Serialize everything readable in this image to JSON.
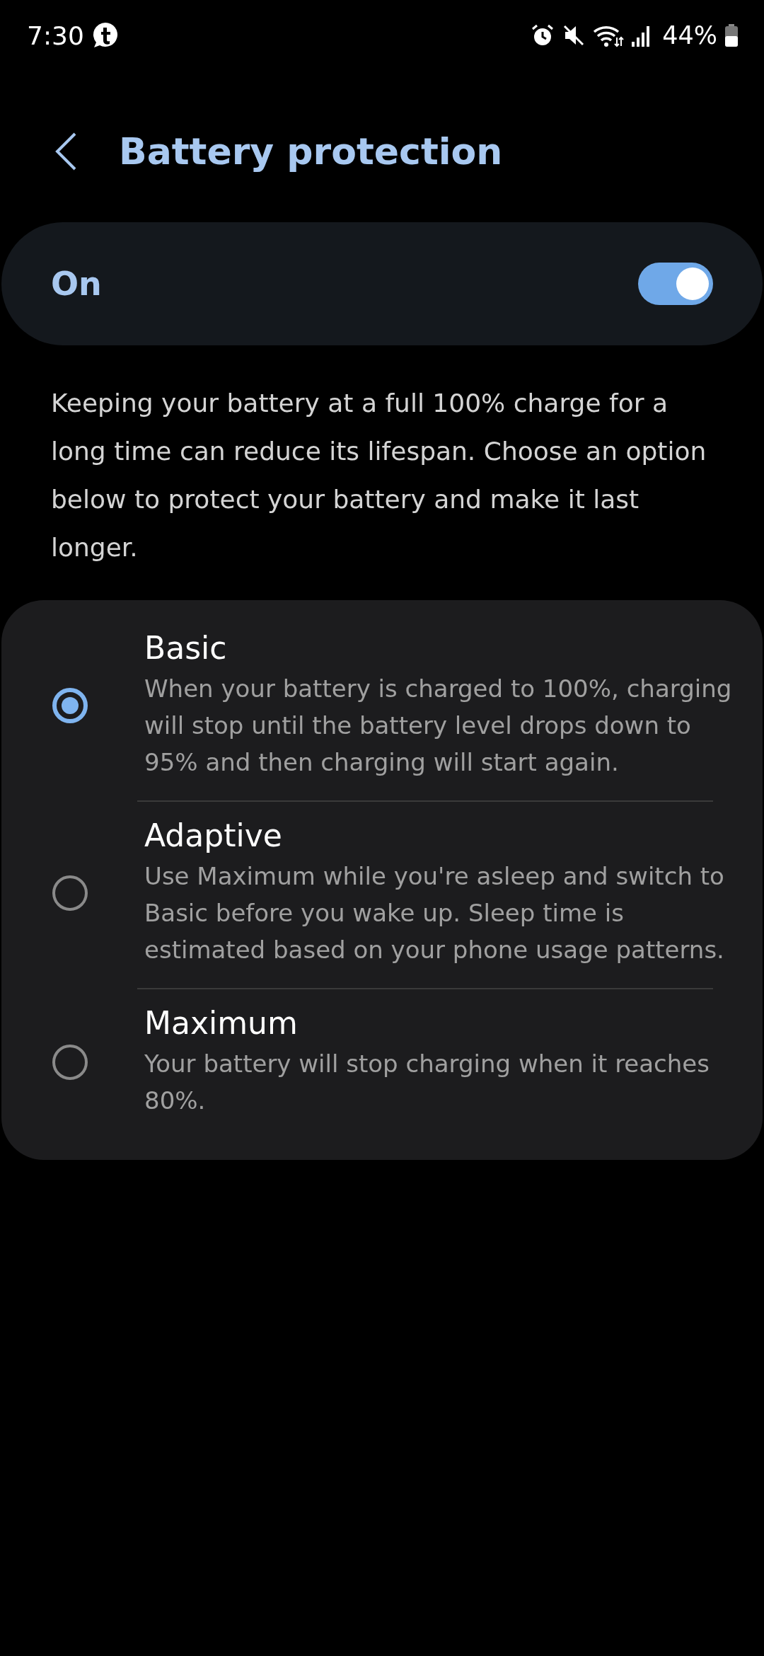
{
  "status_bar": {
    "time": "7:30",
    "battery": "44%"
  },
  "header": {
    "title": "Battery protection"
  },
  "master_switch": {
    "label": "On",
    "on": true
  },
  "description": "Keeping your battery at a full 100% charge for a long time can reduce its lifespan. Choose an option below to protect your battery and make it last longer.",
  "options": [
    {
      "title": "Basic",
      "description": "When your battery is charged to 100%, charging will stop until the battery level drops down to 95% and then charging will start again.",
      "selected": true
    },
    {
      "title": "Adaptive",
      "description": "Use Maximum while you're asleep and switch to Basic before you wake up. Sleep time is estimated based on your phone usage patterns.",
      "selected": false
    },
    {
      "title": "Maximum",
      "description": "Your battery will stop charging when it reaches 80%.",
      "selected": false
    }
  ]
}
